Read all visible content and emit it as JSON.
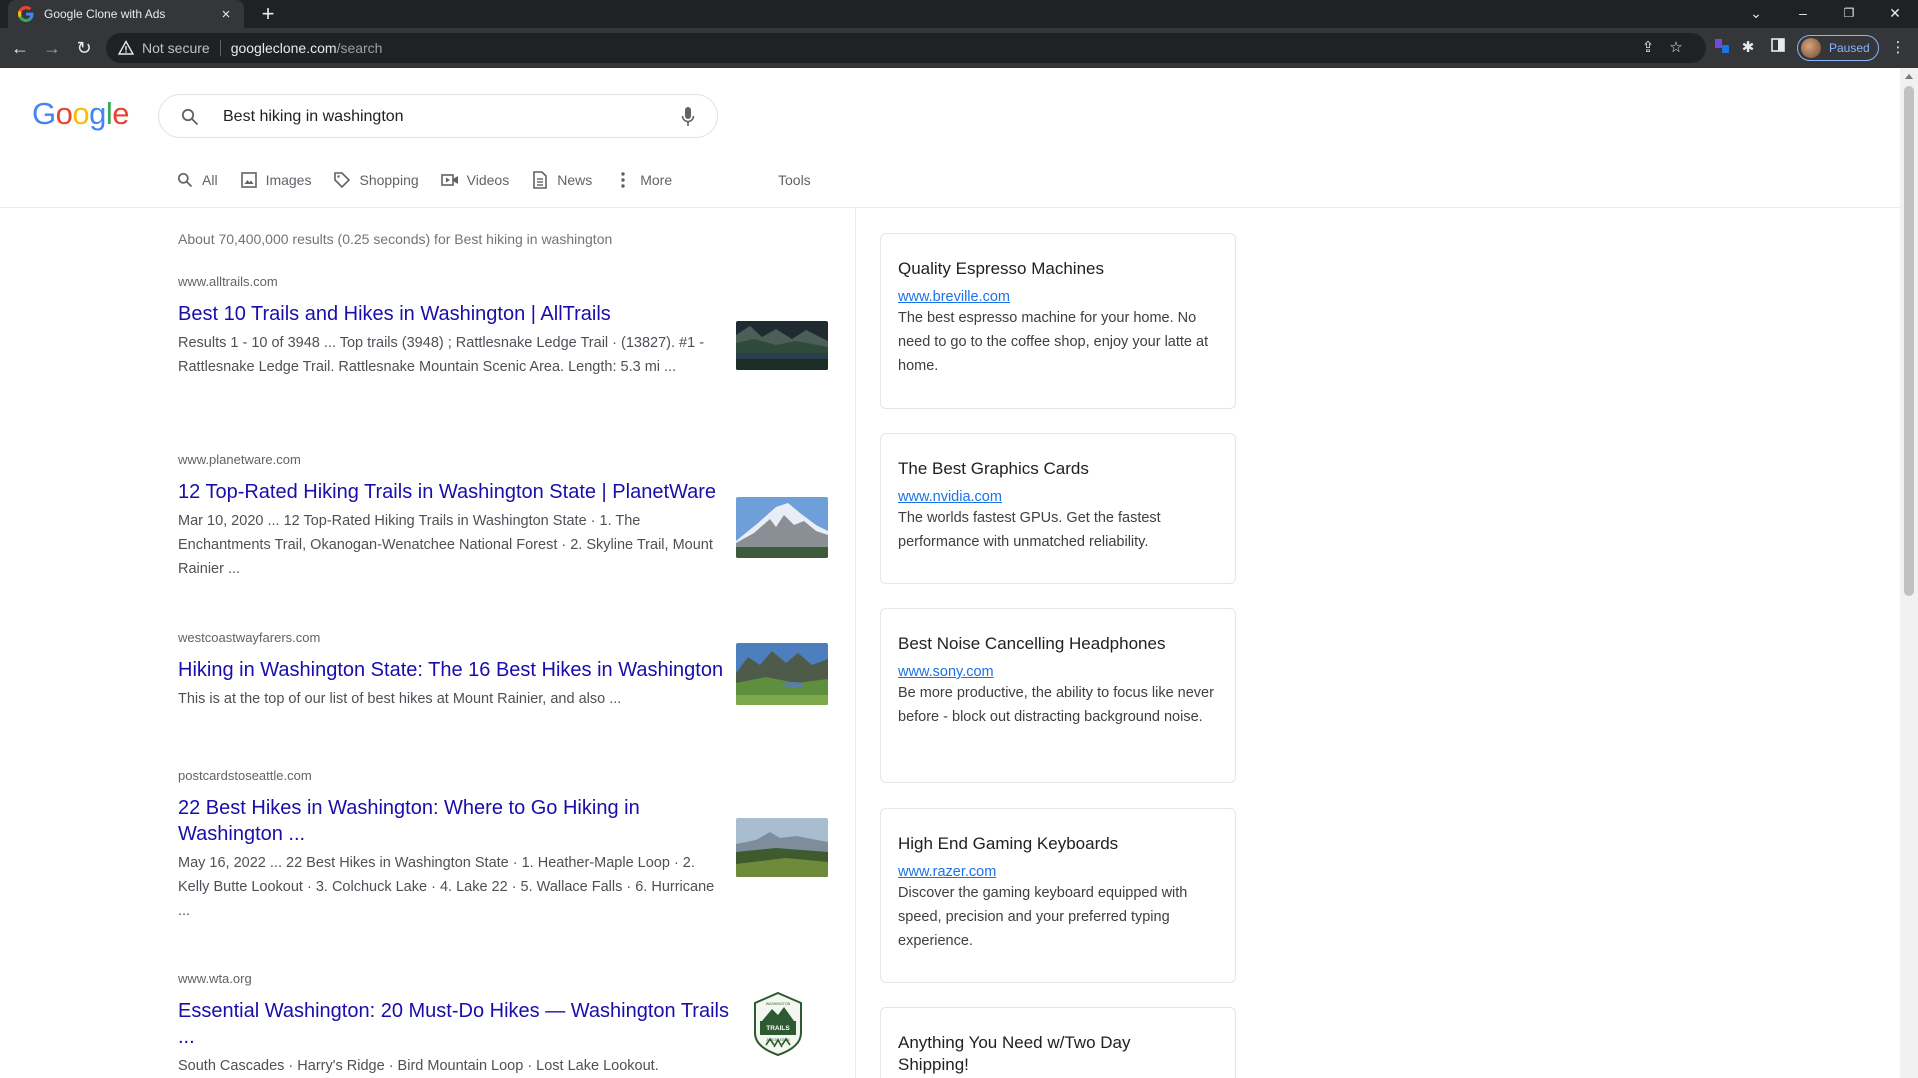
{
  "browser": {
    "tab_title": "Google Clone with Ads",
    "security_label": "Not secure",
    "url_host": "googleclone.com",
    "url_path": "/search",
    "profile_status": "Paused"
  },
  "logo": {
    "letters": [
      "G",
      "o",
      "o",
      "g",
      "l",
      "e"
    ]
  },
  "search": {
    "query": "Best hiking in washington"
  },
  "tabs": [
    {
      "label": "All",
      "icon": "search-icon"
    },
    {
      "label": "Images",
      "icon": "image-icon"
    },
    {
      "label": "Shopping",
      "icon": "tag-icon"
    },
    {
      "label": "Videos",
      "icon": "video-icon"
    },
    {
      "label": "News",
      "icon": "news-icon"
    },
    {
      "label": "More",
      "icon": "more-vert-icon"
    }
  ],
  "tools_label": "Tools",
  "result_stats": "About 70,400,000 results (0.25 seconds) for Best hiking in washington",
  "results": [
    {
      "host": "www.alltrails.com",
      "title": "Best 10 Trails and Hikes in Washington | AllTrails",
      "snippet": "Results 1 - 10 of 3948 ... Top trails (3948) ; Rattlesnake Ledge Trail · (13827). #1 - Rattlesnake Ledge Trail. Rattlesnake Mountain Scenic Area. Length: 5.3 mi ..."
    },
    {
      "host": "www.planetware.com",
      "title": "12 Top-Rated Hiking Trails in Washington State | PlanetWare",
      "snippet": "Mar 10, 2020 ... 12 Top-Rated Hiking Trails in Washington State · 1. The Enchantments Trail, Okanogan-Wenatchee National Forest · 2. Skyline Trail, Mount Rainier ..."
    },
    {
      "host": "westcoastwayfarers.com",
      "title": "Hiking in Washington State: The 16 Best Hikes in Washington",
      "snippet": "This is at the top of our list of best hikes at Mount Rainier, and also ..."
    },
    {
      "host": "postcardstoseattle.com",
      "title": "22 Best Hikes in Washington: Where to Go Hiking in Washington ...",
      "snippet": "May 16, 2022 ... 22 Best Hikes in Washington State · 1. Heather-Maple Loop · 2. Kelly Butte Lookout · 3. Colchuck Lake · 4. Lake 22 · 5. Wallace Falls · 6. Hurricane ..."
    },
    {
      "host": "www.wta.org",
      "title": "Essential Washington: 20 Must-Do Hikes — Washington Trails ...",
      "snippet": "South Cascades · Harry's Ridge · Bird Mountain Loop · Lost Lake Lookout.",
      "logo_text": [
        "WASHINGTON",
        "TRAILS",
        "ASSOCIATION"
      ]
    }
  ],
  "ads": [
    {
      "title": "Quality Espresso Machines",
      "link": "www.breville.com",
      "text": "The best espresso machine for your home. No need to go to the coffee shop, enjoy your latte at home."
    },
    {
      "title": "The Best Graphics Cards",
      "link": "www.nvidia.com",
      "text": "The worlds fastest GPUs. Get the fastest performance with unmatched reliability."
    },
    {
      "title": "Best Noise Cancelling Headphones",
      "link": "www.sony.com",
      "text": "Be more productive, the ability to focus like never before - block out distracting background noise."
    },
    {
      "title": "High End Gaming Keyboards",
      "link": "www.razer.com",
      "text": "Discover the gaming keyboard equipped with speed, precision and your preferred typing experience."
    },
    {
      "title": "Anything You Need w/Two Day Shipping!",
      "link": "",
      "text": ""
    }
  ],
  "colors": {
    "logo": [
      "#4285f4",
      "#ea4335",
      "#fbbc05",
      "#4285f4",
      "#34a853",
      "#ea4335"
    ],
    "link_title": "#1a0dab",
    "ad_link": "#1a73e8",
    "chrome_dark": "#202124"
  }
}
